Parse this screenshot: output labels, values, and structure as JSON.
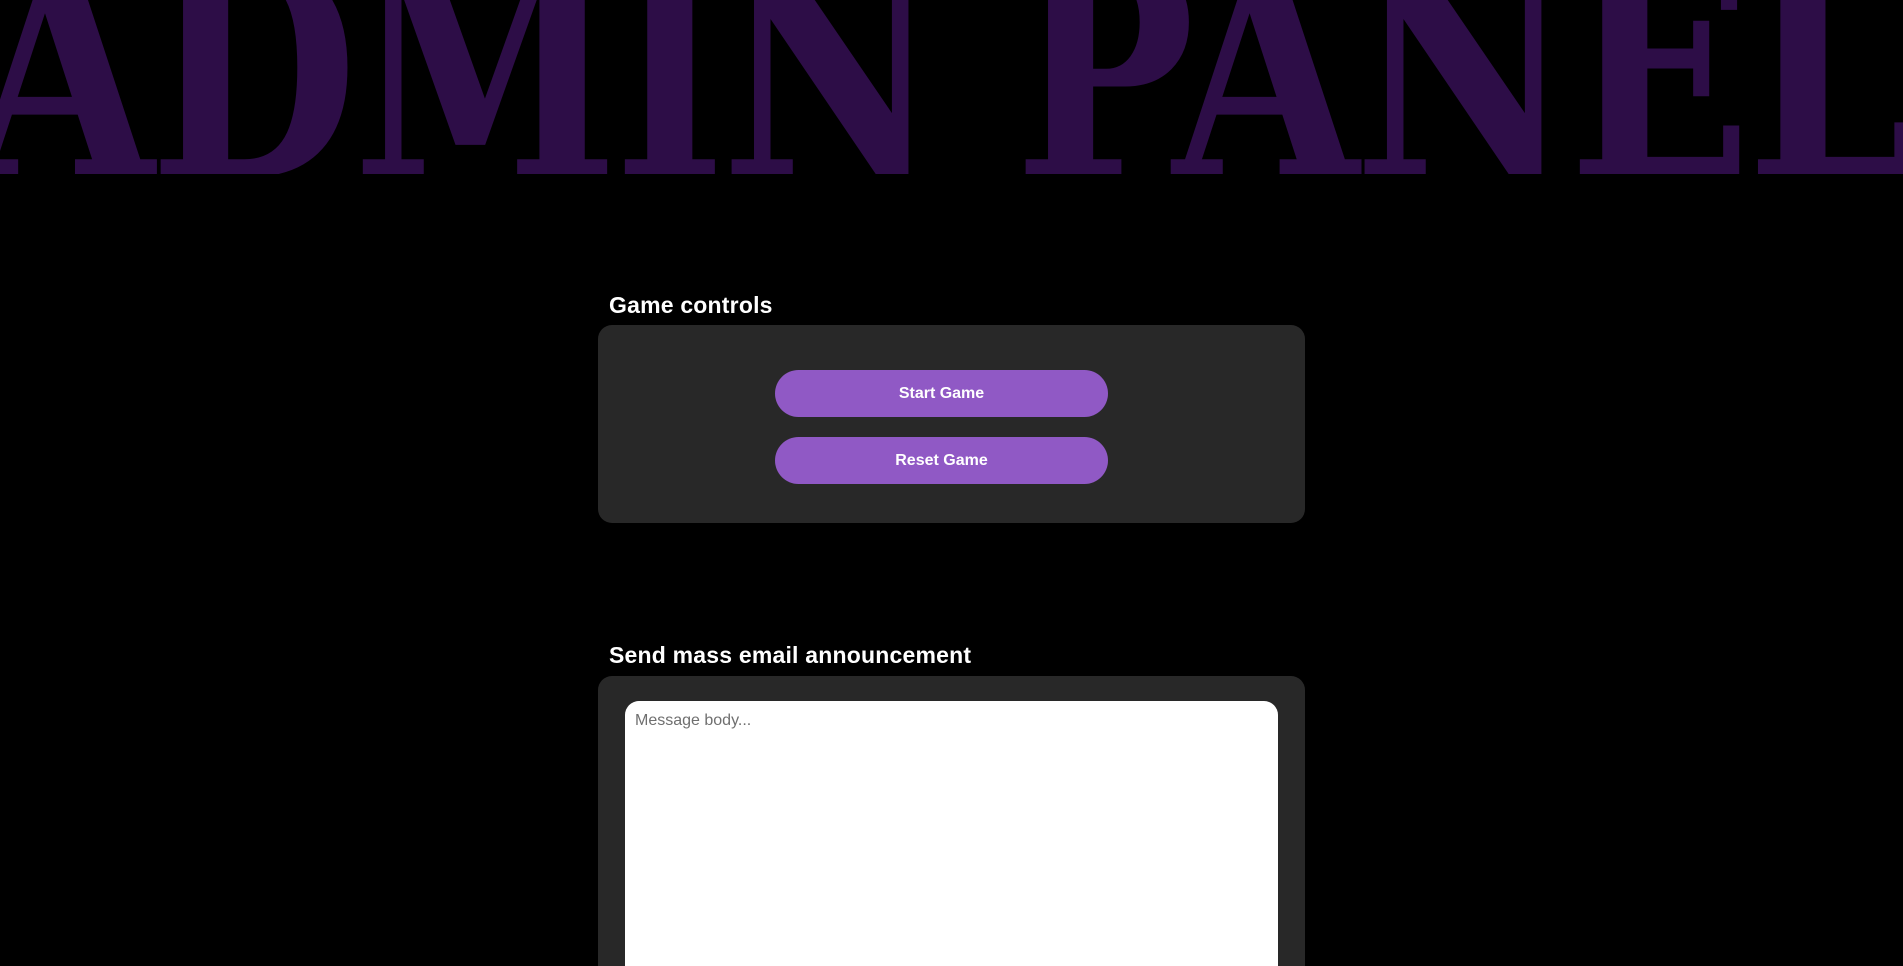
{
  "banner": {
    "title": "ADMIN PANEL"
  },
  "game_controls": {
    "title": "Game controls",
    "start_label": "Start Game",
    "reset_label": "Reset Game"
  },
  "mass_email": {
    "title": "Send mass email announcement",
    "message_placeholder": "Message body...",
    "message_value": ""
  },
  "colors": {
    "background": "#000000",
    "banner": "#2d0d47",
    "panel": "#282828",
    "button": "#9059c5",
    "text": "#ffffff"
  }
}
